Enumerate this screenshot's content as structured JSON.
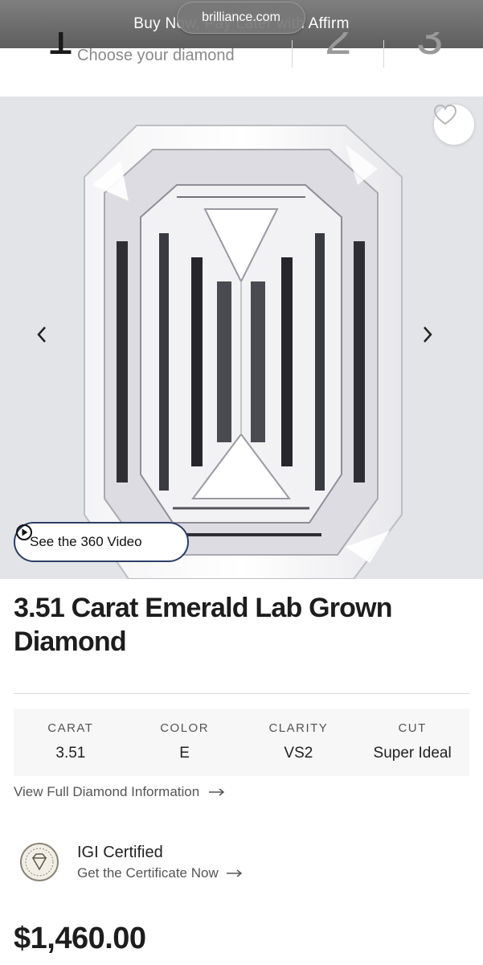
{
  "banner": {
    "promo_text": "Buy Now, Pay Later with Affirm",
    "url": "brilliance.com"
  },
  "steps": {
    "step1_number": "1",
    "step1_label": "Choose your diamond",
    "step2_number": "2",
    "step3_number": "3"
  },
  "gallery": {
    "video_button_label": "See the 360 Video"
  },
  "product": {
    "title": "3.51 Carat Emerald Lab Grown Diamond"
  },
  "specs": [
    {
      "label": "CARAT",
      "value": "3.51"
    },
    {
      "label": "COLOR",
      "value": "E"
    },
    {
      "label": "CLARITY",
      "value": "VS2"
    },
    {
      "label": "CUT",
      "value": "Super Ideal"
    }
  ],
  "details_link": "View Full Diamond Information",
  "certification": {
    "title": "IGI Certified",
    "link": "Get the Certificate Now"
  },
  "price": "$1,460.00",
  "icons": {
    "favorite": "heart-icon",
    "prev": "chevron-left-icon",
    "next": "chevron-right-icon",
    "play": "play-circle-icon",
    "arrow": "arrow-right-icon",
    "cert_badge": "igi-seal-icon"
  },
  "colors": {
    "video_border": "#2c3f66",
    "banner": "#6b6b6b",
    "gallery_bg": "#e3e4e8"
  }
}
